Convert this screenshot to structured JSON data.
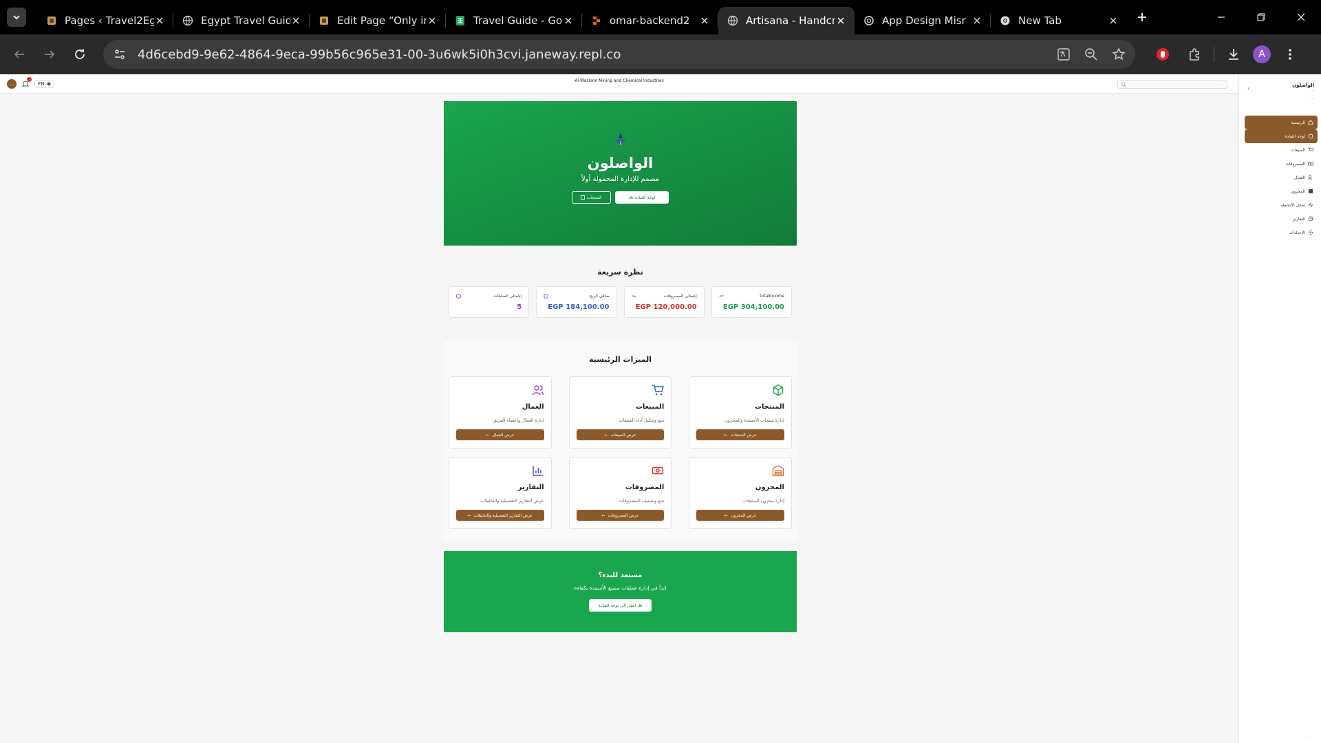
{
  "browser": {
    "tabs": [
      {
        "title": "Pages ‹ Travel2Eg",
        "favicon": "travel2egypt-icon"
      },
      {
        "title": "Egypt Travel Guide",
        "favicon": "globe-icon"
      },
      {
        "title": "Edit Page “Only in",
        "favicon": "travel2egypt-icon"
      },
      {
        "title": "Travel Guide - Go",
        "favicon": "sheets-icon"
      },
      {
        "title": "omar-backend2",
        "favicon": "replit-icon"
      },
      {
        "title": "Artisana - Handcr",
        "favicon": "globe-icon",
        "active": true
      },
      {
        "title": "App Design Misr",
        "favicon": "openai-icon"
      },
      {
        "title": "New Tab",
        "favicon": "chrome-icon"
      }
    ],
    "url": "4d6cebd9-9e62-4864-9eca-99b56c965e31-00-3u6wk5i0h3cvi.janeway.repl.co",
    "profile_initial": "A",
    "colors": {
      "profile": "#8b55c9",
      "extension": "#e0262a"
    }
  },
  "header": {
    "avatar_initial": "…",
    "lang": "EN",
    "company": "Al-Wasloon Mining and Chemical Industries",
    "datetime": "…",
    "search_placeholder": "…"
  },
  "sidebar": {
    "brand_name": "الواصلون",
    "brand_subtitle": "…",
    "version": "…",
    "items": [
      {
        "label": "الرئيسية",
        "icon": "home-icon",
        "active": true
      },
      {
        "label": "لوحة القيادة",
        "icon": "dashboard-icon",
        "active": true
      },
      {
        "label": "المبيعات",
        "icon": "cart-icon"
      },
      {
        "label": "المصروفات",
        "icon": "money-icon"
      },
      {
        "label": "العمال",
        "icon": "users-icon"
      },
      {
        "label": "المخزون",
        "icon": "warehouse-icon"
      },
      {
        "label": "سجل الأنشطة",
        "icon": "activity-icon"
      },
      {
        "label": "التقارير",
        "icon": "report-icon"
      },
      {
        "label": "الإعدادات",
        "icon": "gear-icon"
      }
    ],
    "footer": "…"
  },
  "hero": {
    "title": "الواصلون",
    "subtitle": "مصمم للإدارة المحمولة أولاً",
    "btn_dashboard": "لوحة القيادة",
    "btn_products": "المنتجات"
  },
  "overview": {
    "title": "نظرة سريعة",
    "stats": [
      {
        "label": "totalIncome",
        "value": "EGP 304,100.00",
        "color": "#1f9d4c"
      },
      {
        "label": "إجمالي المصروفات",
        "value": "EGP 120,000.00",
        "color": "#d32f2f"
      },
      {
        "label": "صافي الربح",
        "value": "EGP 184,100.00",
        "color": "#2f5fd3"
      },
      {
        "label": "إجمالي المنتجات",
        "value": "5",
        "color": "#9c3fd8"
      }
    ]
  },
  "features": {
    "title": "الميزات الرئيسية",
    "cards": [
      {
        "title": "المنتجات",
        "desc": "إدارة منتجات الأسمدة والمخزون",
        "btn": "عرض المنتجات",
        "icon": "box-icon",
        "color": "#1f9d4c"
      },
      {
        "title": "المبيعات",
        "desc": "تتبع وتحليل أداء المبيعات",
        "btn": "عرض المبيعات",
        "icon": "cart-icon",
        "color": "#2f5fd3"
      },
      {
        "title": "العمال",
        "desc": "إدارة العمال وأعضاء الفريق",
        "btn": "عرض العمال",
        "icon": "users-icon",
        "color": "#9c3fd8"
      },
      {
        "title": "المخزون",
        "desc": "إدارة مخزون المنتجات",
        "btn": "عرض المخزون",
        "icon": "warehouse-icon",
        "color": "#e8682a"
      },
      {
        "title": "المصروفات",
        "desc": "تتبع وتصنيف المصروفات",
        "btn": "عرض المصروفات",
        "icon": "money-icon",
        "color": "#d32f2f"
      },
      {
        "title": "التقارير",
        "desc": "عرض التقارير التفصيلية والتحليلات",
        "btn": "عرض التقارير التفصيلية والتحليلات",
        "icon": "chart-icon",
        "color": "#3f51d8"
      }
    ]
  },
  "cta": {
    "title": "مستعد للبدء؟",
    "subtitle": "ابدأ في إدارة عمليات مصنع الأسمدة بكفاءة",
    "btn": "انتقل إلى لوحة القيادة"
  },
  "theme": {
    "primary_brown": "#8b5a2b",
    "primary_green": "#1aa64e"
  }
}
